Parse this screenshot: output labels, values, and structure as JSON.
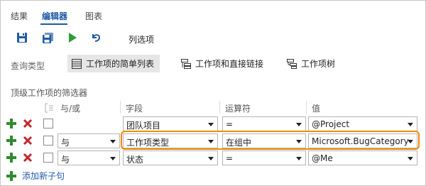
{
  "tabs": [
    {
      "label": "结果"
    },
    {
      "label": "编辑器",
      "active": true
    },
    {
      "label": "图表"
    }
  ],
  "toolbar": {
    "save_icon": "save-icon",
    "save_as_icon": "save-as-icon",
    "run_icon": "run-icon",
    "undo_icon": "undo-icon",
    "column_options_label": "列选项"
  },
  "query_type": {
    "label": "查询类型",
    "options": [
      {
        "label": "工作项的简单列表",
        "icon": "flat-list-icon",
        "selected": true
      },
      {
        "label": "工作项和直接链接",
        "icon": "direct-links-icon",
        "selected": false
      },
      {
        "label": "工作项树",
        "icon": "tree-icon",
        "selected": false
      }
    ]
  },
  "filters": {
    "title": "顶级工作项的筛选器",
    "headers": {
      "and_or": "与/或",
      "field": "字段",
      "operator": "运算符",
      "value": "值"
    },
    "rows": [
      {
        "and_or": "",
        "field": "团队项目",
        "operator": "=",
        "value": "@Project"
      },
      {
        "and_or": "与",
        "field": "工作项类型",
        "operator": "在组中",
        "value": "Microsoft.BugCategory"
      },
      {
        "and_or": "与",
        "field": "状态",
        "operator": "=",
        "value": "@Me"
      }
    ],
    "add_clause_label": "添加新子句"
  },
  "colors": {
    "accent": "#1f5aa6",
    "add_green": "#2e8b2e",
    "delete_red": "#c0262d",
    "highlight_orange": "#f08c00",
    "run_green": "#2e9b3a"
  }
}
